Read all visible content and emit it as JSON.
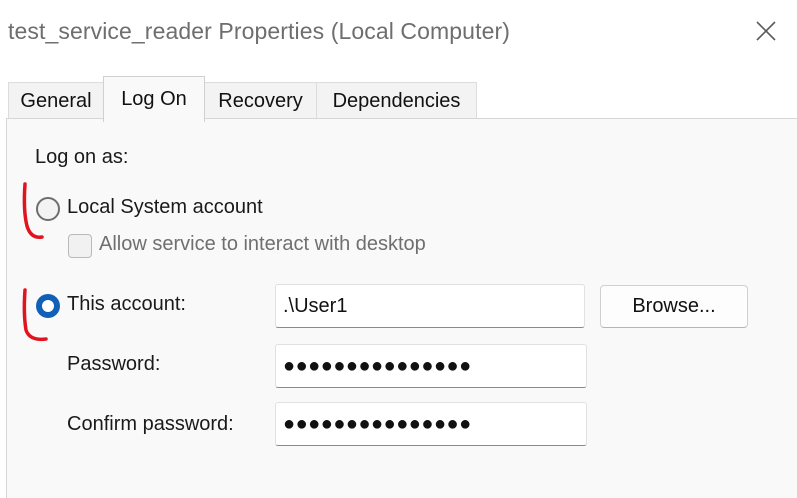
{
  "window": {
    "title": "test_service_reader Properties (Local Computer)"
  },
  "tabs": [
    {
      "label": "General",
      "active": false
    },
    {
      "label": "Log On",
      "active": true
    },
    {
      "label": "Recovery",
      "active": false
    },
    {
      "label": "Dependencies",
      "active": false
    }
  ],
  "logon": {
    "heading": "Log on as:",
    "local_system": {
      "label": "Local System account",
      "selected": false
    },
    "interact_desktop": {
      "label": "Allow service to interact with desktop",
      "checked": false,
      "enabled": false
    },
    "this_account": {
      "label": "This account:",
      "selected": true,
      "value": ".\\User1"
    },
    "password": {
      "label": "Password:",
      "value": "●●●●●●●●●●●●●●●"
    },
    "confirm_password": {
      "label": "Confirm password:",
      "value": "●●●●●●●●●●●●●●●"
    },
    "browse_label": "Browse..."
  },
  "colors": {
    "accent": "#1060b8",
    "annotation": "#e0141e"
  }
}
